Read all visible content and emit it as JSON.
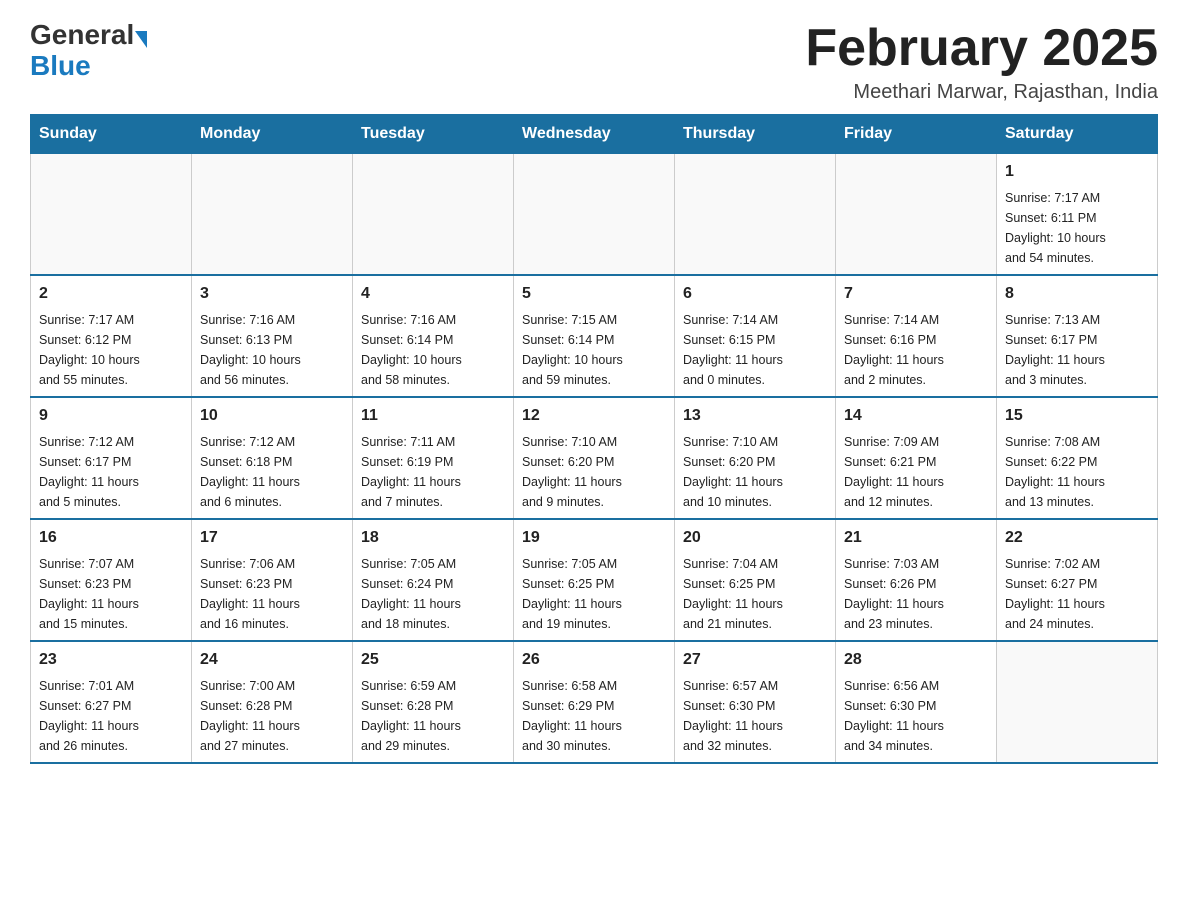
{
  "header": {
    "logo_general": "General",
    "logo_blue": "Blue",
    "title": "February 2025",
    "subtitle": "Meethari Marwar, Rajasthan, India"
  },
  "calendar": {
    "days_of_week": [
      "Sunday",
      "Monday",
      "Tuesday",
      "Wednesday",
      "Thursday",
      "Friday",
      "Saturday"
    ],
    "weeks": [
      [
        {
          "day": "",
          "info": ""
        },
        {
          "day": "",
          "info": ""
        },
        {
          "day": "",
          "info": ""
        },
        {
          "day": "",
          "info": ""
        },
        {
          "day": "",
          "info": ""
        },
        {
          "day": "",
          "info": ""
        },
        {
          "day": "1",
          "info": "Sunrise: 7:17 AM\nSunset: 6:11 PM\nDaylight: 10 hours\nand 54 minutes."
        }
      ],
      [
        {
          "day": "2",
          "info": "Sunrise: 7:17 AM\nSunset: 6:12 PM\nDaylight: 10 hours\nand 55 minutes."
        },
        {
          "day": "3",
          "info": "Sunrise: 7:16 AM\nSunset: 6:13 PM\nDaylight: 10 hours\nand 56 minutes."
        },
        {
          "day": "4",
          "info": "Sunrise: 7:16 AM\nSunset: 6:14 PM\nDaylight: 10 hours\nand 58 minutes."
        },
        {
          "day": "5",
          "info": "Sunrise: 7:15 AM\nSunset: 6:14 PM\nDaylight: 10 hours\nand 59 minutes."
        },
        {
          "day": "6",
          "info": "Sunrise: 7:14 AM\nSunset: 6:15 PM\nDaylight: 11 hours\nand 0 minutes."
        },
        {
          "day": "7",
          "info": "Sunrise: 7:14 AM\nSunset: 6:16 PM\nDaylight: 11 hours\nand 2 minutes."
        },
        {
          "day": "8",
          "info": "Sunrise: 7:13 AM\nSunset: 6:17 PM\nDaylight: 11 hours\nand 3 minutes."
        }
      ],
      [
        {
          "day": "9",
          "info": "Sunrise: 7:12 AM\nSunset: 6:17 PM\nDaylight: 11 hours\nand 5 minutes."
        },
        {
          "day": "10",
          "info": "Sunrise: 7:12 AM\nSunset: 6:18 PM\nDaylight: 11 hours\nand 6 minutes."
        },
        {
          "day": "11",
          "info": "Sunrise: 7:11 AM\nSunset: 6:19 PM\nDaylight: 11 hours\nand 7 minutes."
        },
        {
          "day": "12",
          "info": "Sunrise: 7:10 AM\nSunset: 6:20 PM\nDaylight: 11 hours\nand 9 minutes."
        },
        {
          "day": "13",
          "info": "Sunrise: 7:10 AM\nSunset: 6:20 PM\nDaylight: 11 hours\nand 10 minutes."
        },
        {
          "day": "14",
          "info": "Sunrise: 7:09 AM\nSunset: 6:21 PM\nDaylight: 11 hours\nand 12 minutes."
        },
        {
          "day": "15",
          "info": "Sunrise: 7:08 AM\nSunset: 6:22 PM\nDaylight: 11 hours\nand 13 minutes."
        }
      ],
      [
        {
          "day": "16",
          "info": "Sunrise: 7:07 AM\nSunset: 6:23 PM\nDaylight: 11 hours\nand 15 minutes."
        },
        {
          "day": "17",
          "info": "Sunrise: 7:06 AM\nSunset: 6:23 PM\nDaylight: 11 hours\nand 16 minutes."
        },
        {
          "day": "18",
          "info": "Sunrise: 7:05 AM\nSunset: 6:24 PM\nDaylight: 11 hours\nand 18 minutes."
        },
        {
          "day": "19",
          "info": "Sunrise: 7:05 AM\nSunset: 6:25 PM\nDaylight: 11 hours\nand 19 minutes."
        },
        {
          "day": "20",
          "info": "Sunrise: 7:04 AM\nSunset: 6:25 PM\nDaylight: 11 hours\nand 21 minutes."
        },
        {
          "day": "21",
          "info": "Sunrise: 7:03 AM\nSunset: 6:26 PM\nDaylight: 11 hours\nand 23 minutes."
        },
        {
          "day": "22",
          "info": "Sunrise: 7:02 AM\nSunset: 6:27 PM\nDaylight: 11 hours\nand 24 minutes."
        }
      ],
      [
        {
          "day": "23",
          "info": "Sunrise: 7:01 AM\nSunset: 6:27 PM\nDaylight: 11 hours\nand 26 minutes."
        },
        {
          "day": "24",
          "info": "Sunrise: 7:00 AM\nSunset: 6:28 PM\nDaylight: 11 hours\nand 27 minutes."
        },
        {
          "day": "25",
          "info": "Sunrise: 6:59 AM\nSunset: 6:28 PM\nDaylight: 11 hours\nand 29 minutes."
        },
        {
          "day": "26",
          "info": "Sunrise: 6:58 AM\nSunset: 6:29 PM\nDaylight: 11 hours\nand 30 minutes."
        },
        {
          "day": "27",
          "info": "Sunrise: 6:57 AM\nSunset: 6:30 PM\nDaylight: 11 hours\nand 32 minutes."
        },
        {
          "day": "28",
          "info": "Sunrise: 6:56 AM\nSunset: 6:30 PM\nDaylight: 11 hours\nand 34 minutes."
        },
        {
          "day": "",
          "info": ""
        }
      ]
    ]
  }
}
